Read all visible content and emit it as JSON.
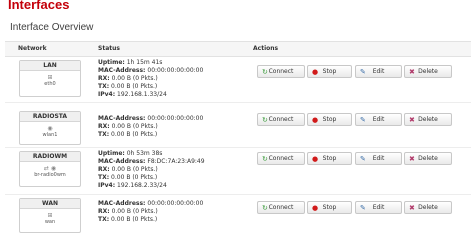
{
  "page": {
    "title": "Interfaces",
    "section": "Interface Overview"
  },
  "table": {
    "headers": {
      "network": "Network",
      "status": "Status",
      "actions": "Actions"
    }
  },
  "actions": {
    "connect": "Connect",
    "stop": "Stop",
    "edit": "Edit",
    "delete": "Delete"
  },
  "interfaces": [
    {
      "name": "LAN",
      "device": "eth0",
      "icon": "ethernet-port-icon",
      "status": [
        {
          "k": "Uptime:",
          "v": "1h 15m 41s"
        },
        {
          "k": "MAC-Address:",
          "v": "00:00:00:00:00:00"
        },
        {
          "k": "RX:",
          "v": "0.00 B (0 Pkts.)"
        },
        {
          "k": "TX:",
          "v": "0.00 B (0 Pkts.)"
        },
        {
          "k": "IPv4:",
          "v": "192.168.1.33/24"
        }
      ]
    },
    {
      "name": "RADIOSTA",
      "device": "wlan1",
      "icon": "wireless-icon",
      "status": [
        {
          "k": "MAC-Address:",
          "v": "00:00:00:00:00:00"
        },
        {
          "k": "RX:",
          "v": "0.00 B (0 Pkts.)"
        },
        {
          "k": "TX:",
          "v": "0.00 B (0 Pkts.)"
        }
      ]
    },
    {
      "name": "RADIOWM",
      "device": "br-radio0wm",
      "icon": "bridge-icon",
      "status": [
        {
          "k": "Uptime:",
          "v": "0h 53m 38s"
        },
        {
          "k": "MAC-Address:",
          "v": "F8:DC:7A:23:A9:49"
        },
        {
          "k": "RX:",
          "v": "0.00 B (0 Pkts.)"
        },
        {
          "k": "TX:",
          "v": "0.00 B (0 Pkts.)"
        },
        {
          "k": "IPv4:",
          "v": "192.168.2.33/24"
        }
      ]
    },
    {
      "name": "WAN",
      "device": "wan",
      "icon": "ethernet-port-icon",
      "status": [
        {
          "k": "MAC-Address:",
          "v": "00:00:00:00:00:00"
        },
        {
          "k": "RX:",
          "v": "0.00 B (0 Pkts.)"
        },
        {
          "k": "TX:",
          "v": "0.00 B (0 Pkts.)"
        }
      ]
    }
  ]
}
